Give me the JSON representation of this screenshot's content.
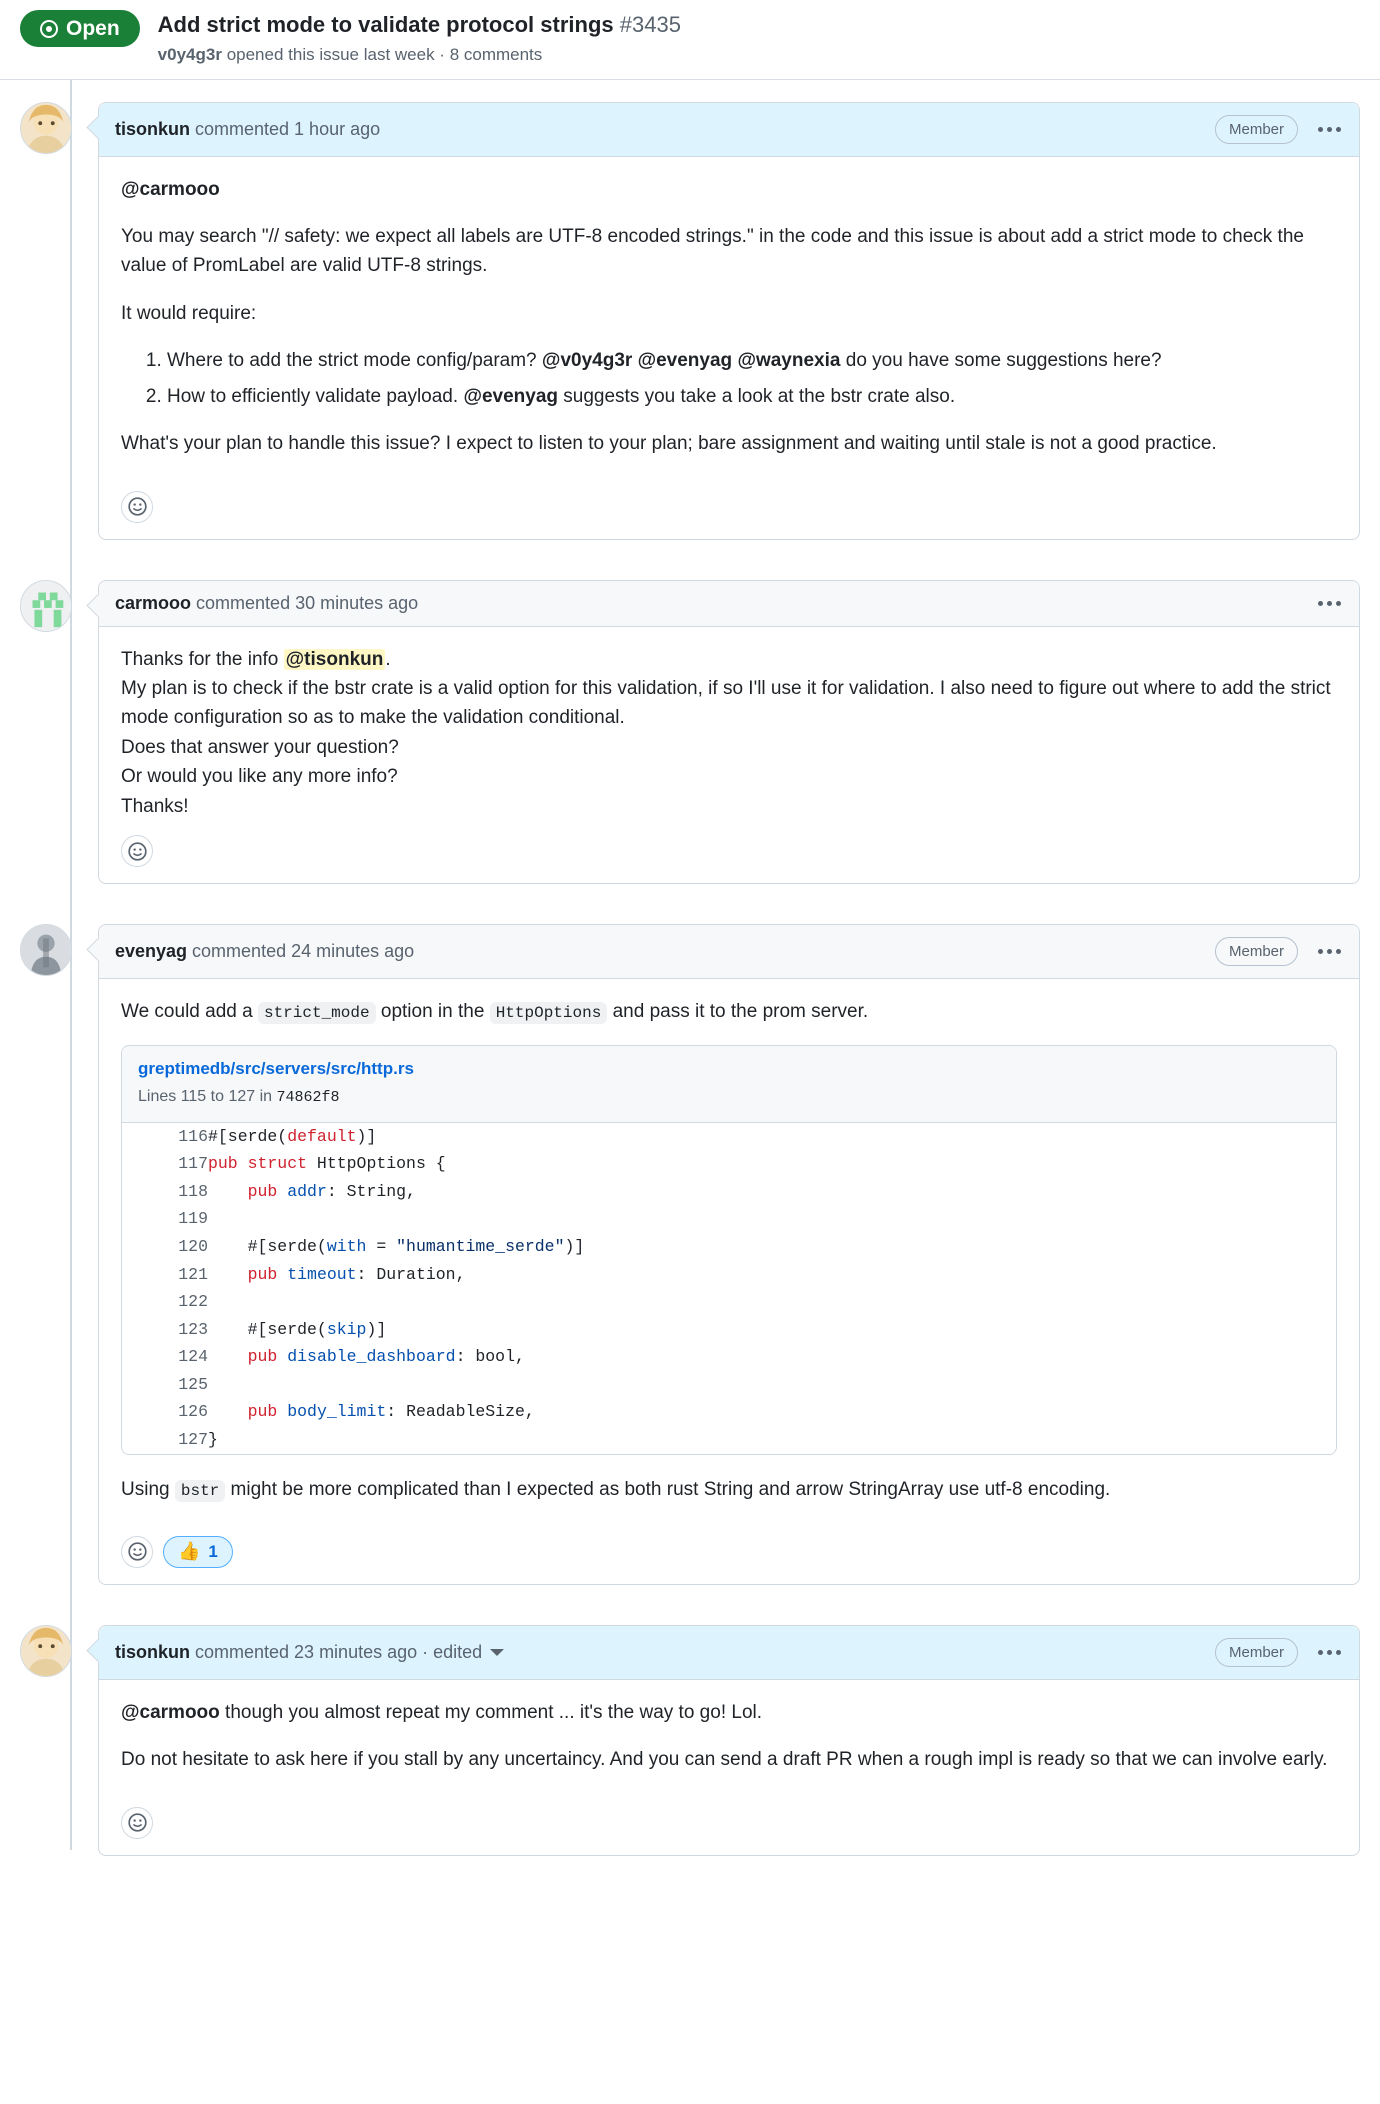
{
  "issue": {
    "state_label": "Open",
    "state_color": "#1a7f37",
    "title": "Add strict mode to validate protocol strings",
    "number": "#3435",
    "author": "v0y4g3r",
    "subtitle_rest": "opened this issue last week · 8 comments"
  },
  "comments": [
    {
      "id": "comment-tisonkun-1",
      "user": "tisonkun",
      "meta": "commented 1 hour ago",
      "role_badge": "Member",
      "highlighted": true,
      "body": {
        "p1": "@carmooo",
        "p2": "You may search \"// safety: we expect all labels are UTF-8 encoded strings.\" in the code and this issue is about add a strict mode to check the value of PromLabel are valid UTF-8 strings.",
        "p3": "It would require:",
        "list": [
          {
            "pre": "Where to add the strict mode config/param? ",
            "m1": "@v0y4g3r",
            "m2": "@evenyag",
            "m3": "@waynexia",
            "post": " do you have some suggestions here?"
          },
          {
            "pre": "How to efficiently validate payload. ",
            "m1": "@evenyag",
            "post": " suggests you take a look at the bstr crate also."
          }
        ],
        "p4": "What's your plan to handle this issue? I expect to listen to your plan; bare assignment and waiting until stale is not a good practice."
      },
      "reactions": {
        "add_label": "add reaction"
      }
    },
    {
      "id": "comment-carmooo",
      "user": "carmooo",
      "meta": "commented 30 minutes ago",
      "role_badge": "",
      "highlighted": false,
      "body": {
        "l1_pre": "Thanks for the info ",
        "l1_mention": "@tisonkun",
        "l1_post": ".",
        "l2": "My plan is to check if the bstr crate is a valid option for this validation, if so I'll use it for validation. I also need to figure out where to add the strict mode configuration so as to make the validation conditional.",
        "l3": "Does that answer your question?",
        "l4": "Or would you like any more info?",
        "l5": "Thanks!"
      },
      "reactions": {
        "add_label": "add reaction"
      }
    },
    {
      "id": "comment-evenyag",
      "user": "evenyag",
      "meta": "commented 24 minutes ago",
      "role_badge": "Member",
      "highlighted": false,
      "body": {
        "p1_a": "We could add a ",
        "p1_code1": "strict_mode",
        "p1_b": " option in the ",
        "p1_code2": "HttpOptions",
        "p1_c": " and pass it to the prom server.",
        "p2_a": "Using ",
        "p2_code": "bstr",
        "p2_b": " might be more complicated than I expected as both rust String and arrow StringArray use utf-8 encoding."
      },
      "snippet": {
        "path": "greptimedb/src/servers/src/http.rs",
        "lines_prefix": "Lines 115 to 127 in ",
        "sha": "74862f8",
        "rows": [
          {
            "n": "116",
            "tokens": [
              {
                "t": "#[serde(",
                "c": "p"
              },
              {
                "t": "default",
                "c": "k"
              },
              {
                "t": ")]",
                "c": "p"
              }
            ]
          },
          {
            "n": "117",
            "tokens": [
              {
                "t": "pub struct",
                "c": "k"
              },
              {
                "t": " HttpOptions {",
                "c": "p"
              }
            ]
          },
          {
            "n": "118",
            "tokens": [
              {
                "t": "    ",
                "c": "p"
              },
              {
                "t": "pub",
                "c": "k"
              },
              {
                "t": " ",
                "c": "p"
              },
              {
                "t": "addr",
                "c": "f"
              },
              {
                "t": ": String,",
                "c": "p"
              }
            ]
          },
          {
            "n": "119",
            "tokens": [
              {
                "t": "",
                "c": "p"
              }
            ]
          },
          {
            "n": "120",
            "tokens": [
              {
                "t": "    #[serde(",
                "c": "p"
              },
              {
                "t": "with",
                "c": "f"
              },
              {
                "t": " = ",
                "c": "p"
              },
              {
                "t": "\"humantime_serde\"",
                "c": "s"
              },
              {
                "t": ")]",
                "c": "p"
              }
            ]
          },
          {
            "n": "121",
            "tokens": [
              {
                "t": "    ",
                "c": "p"
              },
              {
                "t": "pub",
                "c": "k"
              },
              {
                "t": " ",
                "c": "p"
              },
              {
                "t": "timeout",
                "c": "f"
              },
              {
                "t": ": Duration,",
                "c": "p"
              }
            ]
          },
          {
            "n": "122",
            "tokens": [
              {
                "t": "",
                "c": "p"
              }
            ]
          },
          {
            "n": "123",
            "tokens": [
              {
                "t": "    #[serde(",
                "c": "p"
              },
              {
                "t": "skip",
                "c": "f"
              },
              {
                "t": ")]",
                "c": "p"
              }
            ]
          },
          {
            "n": "124",
            "tokens": [
              {
                "t": "    ",
                "c": "p"
              },
              {
                "t": "pub",
                "c": "k"
              },
              {
                "t": " ",
                "c": "p"
              },
              {
                "t": "disable_dashboard",
                "c": "f"
              },
              {
                "t": ": bool,",
                "c": "p"
              }
            ]
          },
          {
            "n": "125",
            "tokens": [
              {
                "t": "",
                "c": "p"
              }
            ]
          },
          {
            "n": "126",
            "tokens": [
              {
                "t": "    ",
                "c": "p"
              },
              {
                "t": "pub",
                "c": "k"
              },
              {
                "t": " ",
                "c": "p"
              },
              {
                "t": "body_limit",
                "c": "f"
              },
              {
                "t": ": ReadableSize,",
                "c": "p"
              }
            ]
          },
          {
            "n": "127",
            "tokens": [
              {
                "t": "}",
                "c": "p"
              }
            ]
          }
        ]
      },
      "reactions": {
        "add_label": "add reaction",
        "pill_emoji": "👍",
        "pill_count": "1"
      }
    },
    {
      "id": "comment-tisonkun-2",
      "user": "tisonkun",
      "meta": "commented 23 minutes ago · edited",
      "role_badge": "Member",
      "highlighted": true,
      "body": {
        "p1_mention": "@carmooo",
        "p1_rest": " though you almost repeat my comment ... it's the way to go! Lol.",
        "p2": "Do not hesitate to ask here if you stall by any uncertaincy. And you can send a draft PR when a rough impl is ready so that we can involve early."
      },
      "reactions": {
        "add_label": "add reaction"
      }
    }
  ]
}
